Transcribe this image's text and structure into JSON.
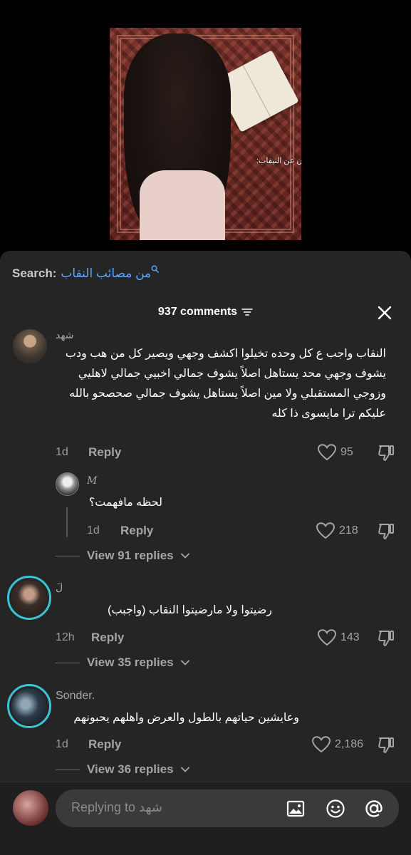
{
  "video": {
    "caption": "افتارات اللي يدافعون عن النيقاب:"
  },
  "search": {
    "label": "Search:",
    "term": "من مصائب النقاب"
  },
  "header": {
    "comments_count": "937 comments"
  },
  "comments": [
    {
      "username": "شهد",
      "text": "النقاب واجب ع كل وحده تخيلوا اكشف وجهي ويصير كل من هب ودب يشوف وجهي محد يستاهل اصلاً يشوف جمالي اخبيي جمالي لاهليي وزوجي المستقبلي ولا مين اصلاً يستاهل يشوف جمالي صحصحو بالله عليكم ترا مايسوى ذا كله",
      "time": "1d",
      "reply": "Reply",
      "likes": "95"
    },
    {
      "username": "M",
      "text": "لحظه مافهمت؟",
      "time": "1d",
      "reply": "Reply",
      "likes": "218"
    },
    {
      "username": "لَ",
      "text": "رضيتوا ولا مارضيتوا النقاب (واجبب)",
      "time": "12h",
      "reply": "Reply",
      "likes": "143"
    },
    {
      "username": "Sonder.",
      "text": "وعايشين حياتهم بالطول والعرض واهلهم يحبونهم",
      "time": "1d",
      "reply": "Reply",
      "likes": "2,186"
    }
  ],
  "view_replies": [
    "View 91 replies",
    "View 35 replies",
    "View 36 replies"
  ],
  "input": {
    "placeholder": "Replying to شهد"
  },
  "colors": {
    "sheet_bg": "#252525",
    "search_term": "#5aa8ff",
    "ring": "#39c5d6"
  }
}
